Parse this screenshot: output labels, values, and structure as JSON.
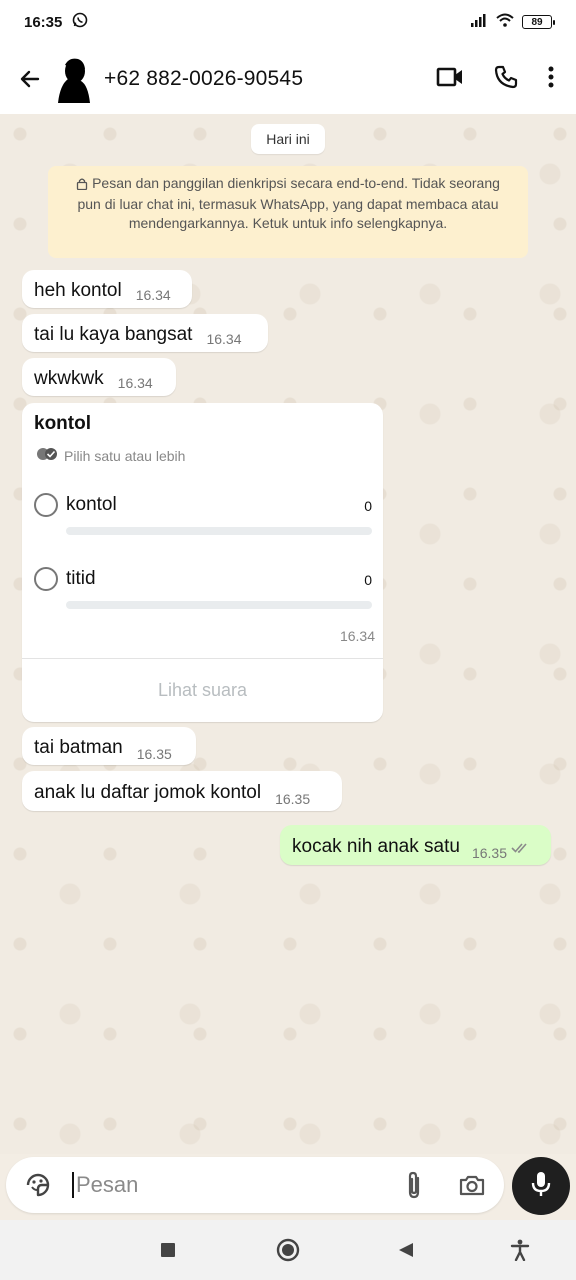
{
  "status_bar": {
    "time": "16:35",
    "battery": "89",
    "icons": [
      "whatsapp-icon",
      "signal-icon",
      "wifi-icon",
      "battery-icon"
    ]
  },
  "header": {
    "contact_name": "+62 882-0026-90545",
    "icons": [
      "back-arrow-icon",
      "avatar",
      "video-call-icon",
      "phone-icon",
      "more-options-icon"
    ]
  },
  "chat": {
    "date_chip": "Hari ini",
    "encryption_notice": "Pesan dan panggilan dienkripsi secara end-to-end. Tidak seorang pun di luar chat ini, termasuk WhatsApp, yang dapat membaca atau mendengarkannya. Ketuk untuk info selengkapnya.",
    "messages": [
      {
        "text": "heh kontol",
        "time": "16.34",
        "direction": "in"
      },
      {
        "text": "tai lu kaya bangsat",
        "time": "16.34",
        "direction": "in"
      },
      {
        "text": "wkwkwk",
        "time": "16.34",
        "direction": "in"
      },
      {
        "text": "tai batman",
        "time": "16.35",
        "direction": "in"
      },
      {
        "text": "anak lu daftar jomok kontol",
        "time": "16.35",
        "direction": "in"
      },
      {
        "text": "kocak nih anak satu",
        "time": "16.35",
        "direction": "out",
        "status": "read"
      }
    ],
    "poll": {
      "title": "kontol",
      "hint": "Pilih satu atau lebih",
      "options": [
        {
          "label": "kontol",
          "votes": "0",
          "fraction": 0
        },
        {
          "label": "titid",
          "votes": "0",
          "fraction": 0
        }
      ],
      "time": "16.34",
      "view_votes_label": "Lihat suara"
    }
  },
  "composer": {
    "placeholder": "Pesan",
    "value": "",
    "icons": [
      "sticker-icon",
      "attach-icon",
      "camera-icon",
      "mic-icon"
    ]
  },
  "navbar": {
    "icons": [
      "recents-icon",
      "home-icon",
      "back-icon",
      "accessibility-icon"
    ]
  },
  "colors": {
    "outgoing_bubble": "#dafdc7",
    "incoming_bubble": "#ffffff",
    "notice_bg": "#fdf0cf",
    "chat_bg": "#f1ebe2"
  }
}
